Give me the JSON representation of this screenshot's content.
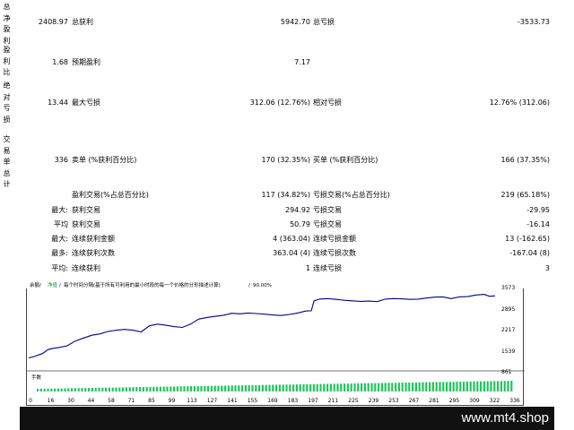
{
  "left_labels": [
    "总净盈利",
    "盈利比",
    "绝对亏损",
    "交易单总计"
  ],
  "rows": [
    {
      "v1": "2408.97",
      "l2": "总获利",
      "v2": "5942.70",
      "l3": "总亏损",
      "v3": "-3533.73"
    },
    {
      "v1": "1.68",
      "l2": "预期盈利",
      "v2": "7.17"
    },
    {
      "v1": "13.44",
      "l2": "最大亏损",
      "v2": "312.06 (12.76%)",
      "l3": "相对亏损",
      "v3": "12.76% (312.06)"
    },
    {
      "v1": "336",
      "l2": "卖单 (%获利百分比)",
      "v2": "170 (32.35%)",
      "l3": "买单 (%获利百分比)",
      "v3": "166 (37.35%)"
    },
    {
      "l2": "盈利交易(%占总百分比)",
      "v2": "117 (34.82%)",
      "l3": "亏损交易(%占总百分比)",
      "v3": "219 (65.18%)"
    },
    {
      "l1": "最大:",
      "l2": "获利交易",
      "v2": "294.92",
      "l3": "亏损交易",
      "v3": "-29.95"
    },
    {
      "l1": "平均",
      "l2": "获利交易",
      "v2": "50.79",
      "l3": "亏损交易",
      "v3": "-16.14"
    },
    {
      "l1": "最大:",
      "l2": "连续获利金额",
      "v2": "4 (363.04)",
      "l3": "连续亏损金额",
      "v3": "13 (-162.65)"
    },
    {
      "l1": "最多:",
      "l2": "连续获利次数",
      "v2": "363.04 (4)",
      "l3": "连续亏损次数",
      "v3": "-167.04 (8)"
    },
    {
      "l1": "平均:",
      "l2": "连续获利",
      "v2": "1",
      "l3": "连续亏损",
      "v3": "3"
    }
  ],
  "chart_data": {
    "type": "line",
    "legend": {
      "balance": "余额",
      "equity": "净值",
      "note": "每个时间分隔(基于所有可利用的最小时段的每一个价格的分形描述计算)",
      "quality": "90.00%"
    },
    "y_ticks": [
      "3573",
      "2895",
      "2217",
      "1539",
      "861"
    ],
    "x_ticks": [
      "0",
      "16",
      "30",
      "44",
      "58",
      "71",
      "85",
      "99",
      "113",
      "127",
      "141",
      "155",
      "169",
      "183",
      "197",
      "211",
      "225",
      "239",
      "253",
      "267",
      "281",
      "295",
      "309",
      "322",
      "336"
    ],
    "volume_label": "手数",
    "ylim": [
      861,
      3700
    ],
    "xlim": [
      0,
      340
    ],
    "colors": {
      "balance": "#00008b",
      "equity": "#00aa44",
      "volume": "#22c55e"
    },
    "series": [
      {
        "name": "余额",
        "x": [
          0,
          5,
          10,
          14,
          18,
          22,
          28,
          34,
          40,
          46,
          52,
          58,
          64,
          70,
          76,
          82,
          88,
          94,
          100,
          106,
          112,
          118,
          124,
          130,
          136,
          142,
          148,
          154,
          160,
          166,
          172,
          178,
          184,
          190,
          196,
          202,
          206,
          208,
          212,
          218,
          224,
          230,
          236,
          242,
          248,
          254,
          260,
          266,
          272,
          278,
          284,
          290,
          296,
          302,
          308,
          314,
          320,
          326,
          332,
          336,
          340
        ],
        "y": [
          1260,
          1330,
          1420,
          1560,
          1610,
          1640,
          1700,
          1870,
          1980,
          2080,
          2130,
          2220,
          2260,
          2290,
          2260,
          2200,
          2420,
          2480,
          2440,
          2390,
          2360,
          2480,
          2660,
          2720,
          2760,
          2800,
          2870,
          2850,
          2880,
          2860,
          2840,
          2810,
          2790,
          2830,
          2880,
          2950,
          2960,
          3320,
          3380,
          3400,
          3370,
          3340,
          3320,
          3300,
          3310,
          3290,
          3380,
          3400,
          3390,
          3370,
          3380,
          3420,
          3450,
          3460,
          3400,
          3460,
          3470,
          3530,
          3550,
          3480,
          3500
        ]
      }
    ]
  },
  "watermark": "www.mt4.shop"
}
